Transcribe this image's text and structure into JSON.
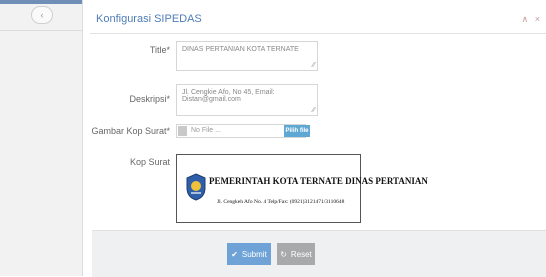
{
  "sidebar": {
    "toggle_icon": "chevron-left-icon"
  },
  "panel": {
    "title": "Konfigurasi SIPEDAS",
    "header_icons": "∧ ×"
  },
  "form": {
    "title_label": "Title*",
    "title_value": "DINAS PERTANIAN KOTA TERNATE",
    "deskripsi_label": "Deskripsi*",
    "deskripsi_value": "Jl. Cengkie Afo, No 45, Email: Distan@gmail.com",
    "gambar_label": "Gambar Kop Surat*",
    "file_placeholder": "No File ...",
    "file_button": "Pilih file",
    "kop_label": "Kop Surat"
  },
  "kop": {
    "title": "PEMERINTAH KOTA TERNATE DINAS PERTANIAN",
    "address": "Jl. Cengkeh Afo No. 4 Telp/Fax: (0921)3121471/3110648"
  },
  "actions": {
    "submit": "Submit",
    "reset": "Reset"
  },
  "colors": {
    "accent": "#4f7db8",
    "submit": "#6fa3d8",
    "reset": "#a7a9ab"
  }
}
